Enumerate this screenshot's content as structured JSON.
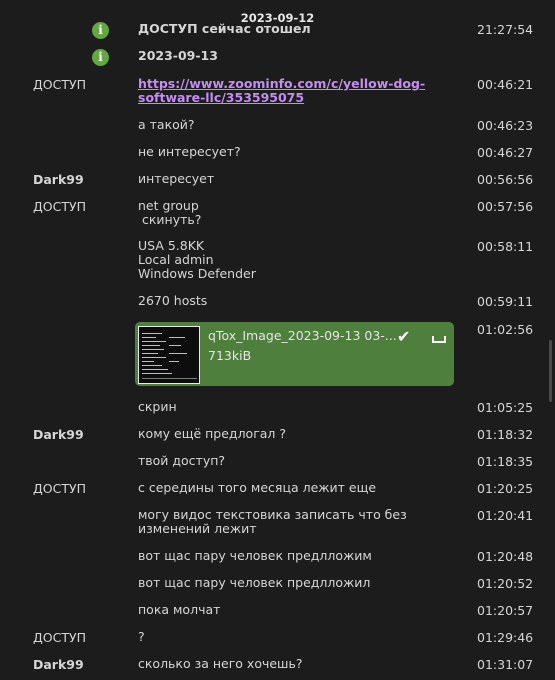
{
  "date_header": "2023-09-12",
  "system_cutoff": "ДОСТУП сейчас отошел",
  "system_cutoff_time": "21:27:54",
  "date_marker": "2023-09-13",
  "info_glyph": "i",
  "accent_color": "#62a83e",
  "link_color": "#c38df2",
  "messages": [
    {
      "sender": "ДОСТУП",
      "lines": [
        "https://www.zoominfo.com/c/yellow-dog-",
        "software-llc/353595075"
      ],
      "time": "00:46:21"
    },
    {
      "sender": "",
      "lines": [
        "а такой?"
      ],
      "time": "00:46:23"
    },
    {
      "sender": "",
      "lines": [
        "не интересует?"
      ],
      "time": "00:46:27"
    },
    {
      "sender": "Dark99",
      "lines": [
        "интересует"
      ],
      "time": "00:56:56"
    },
    {
      "sender": "ДОСТУП",
      "lines": [
        "net group",
        " скинуть?"
      ],
      "time": "00:57:56"
    },
    {
      "sender": "",
      "lines": [
        "USA 5.8KK",
        "Local admin",
        "Windows Defender"
      ],
      "time": "00:58:11"
    },
    {
      "sender": "",
      "lines": [
        "2670 hosts"
      ],
      "time": "00:59:11"
    },
    {
      "sender": "",
      "lines": [
        "скрин"
      ],
      "time": "01:05:25"
    },
    {
      "sender": "Dark99",
      "lines": [
        "кому ещё предлогал ?"
      ],
      "time": "01:18:32"
    },
    {
      "sender": "",
      "lines": [
        "твой доступ?"
      ],
      "time": "01:18:35"
    },
    {
      "sender": "ДОСТУП",
      "lines": [
        "с середины того месяца лежит еще"
      ],
      "time": "01:20:25"
    },
    {
      "sender": "",
      "lines": [
        "могу видос текстовика записать что без",
        "изменений лежит"
      ],
      "time": "01:20:41"
    },
    {
      "sender": "",
      "lines": [
        "вот щас пару человек предлложим"
      ],
      "time": "01:20:48"
    },
    {
      "sender": "",
      "lines": [
        "вот щас пару человек предлложил"
      ],
      "time": "01:20:52"
    },
    {
      "sender": "",
      "lines": [
        "пока молчат"
      ],
      "time": "01:20:57"
    },
    {
      "sender": "ДОСТУП",
      "lines": [
        "?"
      ],
      "time": "01:29:46"
    },
    {
      "sender": "Dark99",
      "lines": [
        "сколько за него хочешь?"
      ],
      "time": "01:31:07"
    }
  ],
  "file_transfer": {
    "name": "qTox_Image_2023-09-13 03-...",
    "size": "713kiB",
    "time": "01:02:56",
    "check_glyph": "✔"
  }
}
